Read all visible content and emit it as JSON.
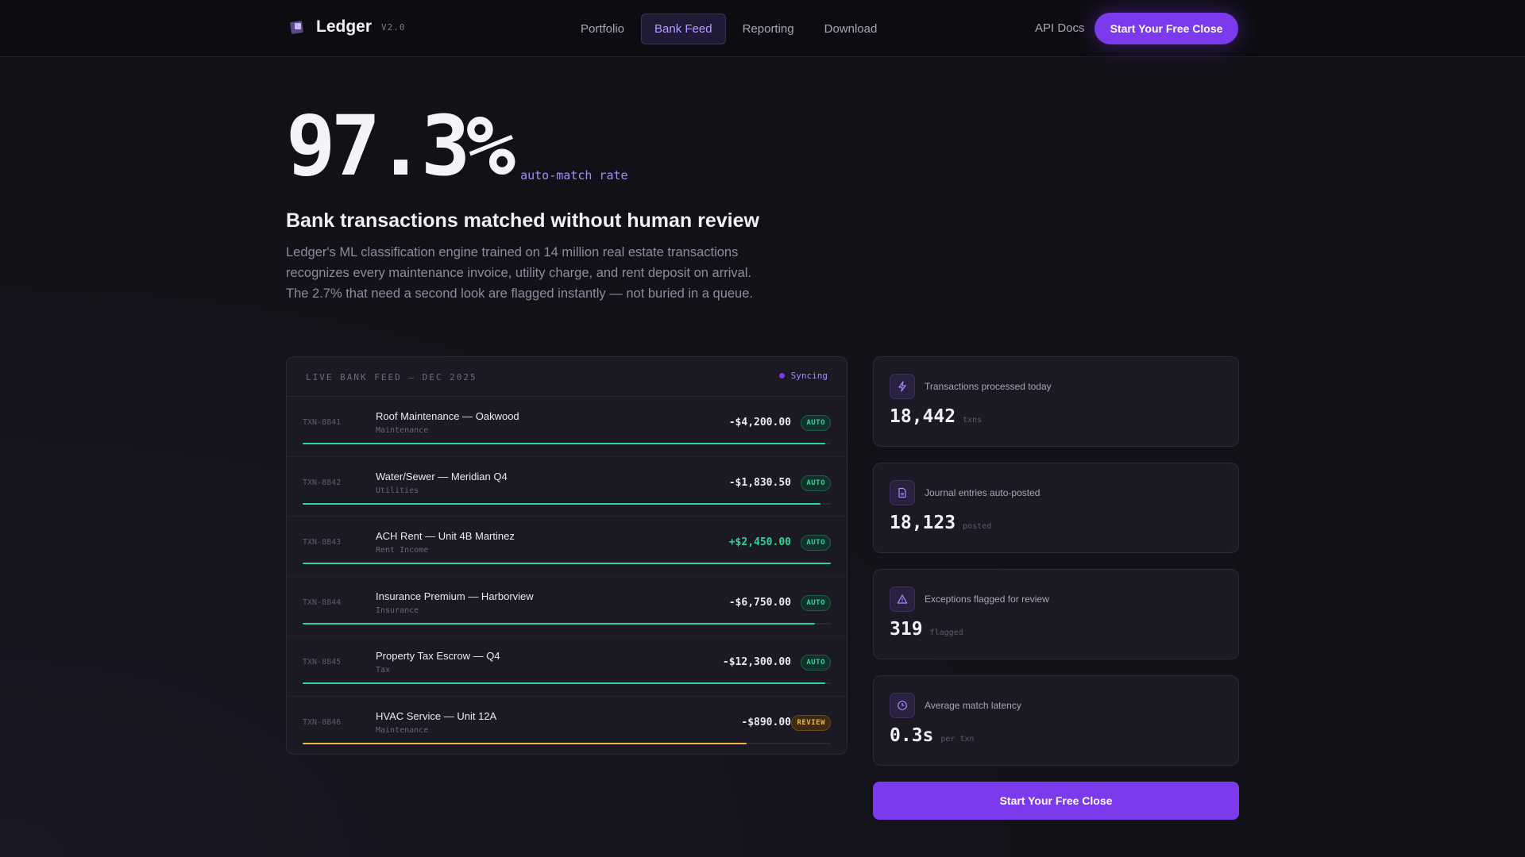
{
  "nav": {
    "brand": "Ledger",
    "version": "V2.0",
    "links": [
      "Portfolio",
      "Bank Feed",
      "Reporting",
      "Download"
    ],
    "active_link": "Bank Feed",
    "api_docs": "API Docs",
    "cta": "Start Your Free Close"
  },
  "hero": {
    "stat": "97.3%",
    "stat_caption": "auto-match rate",
    "title": "Bank transactions matched without human review",
    "body": "Ledger's ML classification engine trained on 14 million real estate transactions recognizes every maintenance invoice, utility charge, and rent deposit on arrival. The 2.7% that need a second look are flagged instantly — not buried in a queue."
  },
  "feed": {
    "title": "LIVE BANK FEED — DEC 2025",
    "status": "Syncing",
    "rows": [
      {
        "id": "TXN-8841",
        "name": "Roof Maintenance — Oakwood",
        "category": "Maintenance",
        "amount": "-$4,200.00",
        "badge": "AUTO",
        "confidence": 0.99
      },
      {
        "id": "TXN-8842",
        "name": "Water/Sewer — Meridian Q4",
        "category": "Utilities",
        "amount": "-$1,830.50",
        "badge": "AUTO",
        "confidence": 0.98
      },
      {
        "id": "TXN-8843",
        "name": "ACH Rent — Unit 4B Martinez",
        "category": "Rent Income",
        "amount": "+$2,450.00",
        "badge": "AUTO",
        "confidence": 1.0
      },
      {
        "id": "TXN-8844",
        "name": "Insurance Premium — Harborview",
        "category": "Insurance",
        "amount": "-$6,750.00",
        "badge": "AUTO",
        "confidence": 0.97
      },
      {
        "id": "TXN-8845",
        "name": "Property Tax Escrow — Q4",
        "category": "Tax",
        "amount": "-$12,300.00",
        "badge": "AUTO",
        "confidence": 0.99
      },
      {
        "id": "TXN-8846",
        "name": "HVAC Service — Unit 12A",
        "category": "Maintenance",
        "amount": "-$890.00",
        "badge": "REVIEW",
        "confidence": 0.84
      }
    ]
  },
  "stats": [
    {
      "icon": "lightning-icon",
      "label": "Transactions processed today",
      "value": "18,442",
      "unit": "txns"
    },
    {
      "icon": "document-icon",
      "label": "Journal entries auto-posted",
      "value": "18,123",
      "unit": "posted"
    },
    {
      "icon": "warning-icon",
      "label": "Exceptions flagged for review",
      "value": "319",
      "unit": "flagged"
    },
    {
      "icon": "clock-icon",
      "label": "Average match latency",
      "value": "0.3s",
      "unit": "per txn"
    }
  ],
  "cta_bottom": "Start Your Free Close",
  "colors": {
    "accent": "#7c3aed",
    "auto": "#34d399",
    "review": "#f5b544"
  }
}
